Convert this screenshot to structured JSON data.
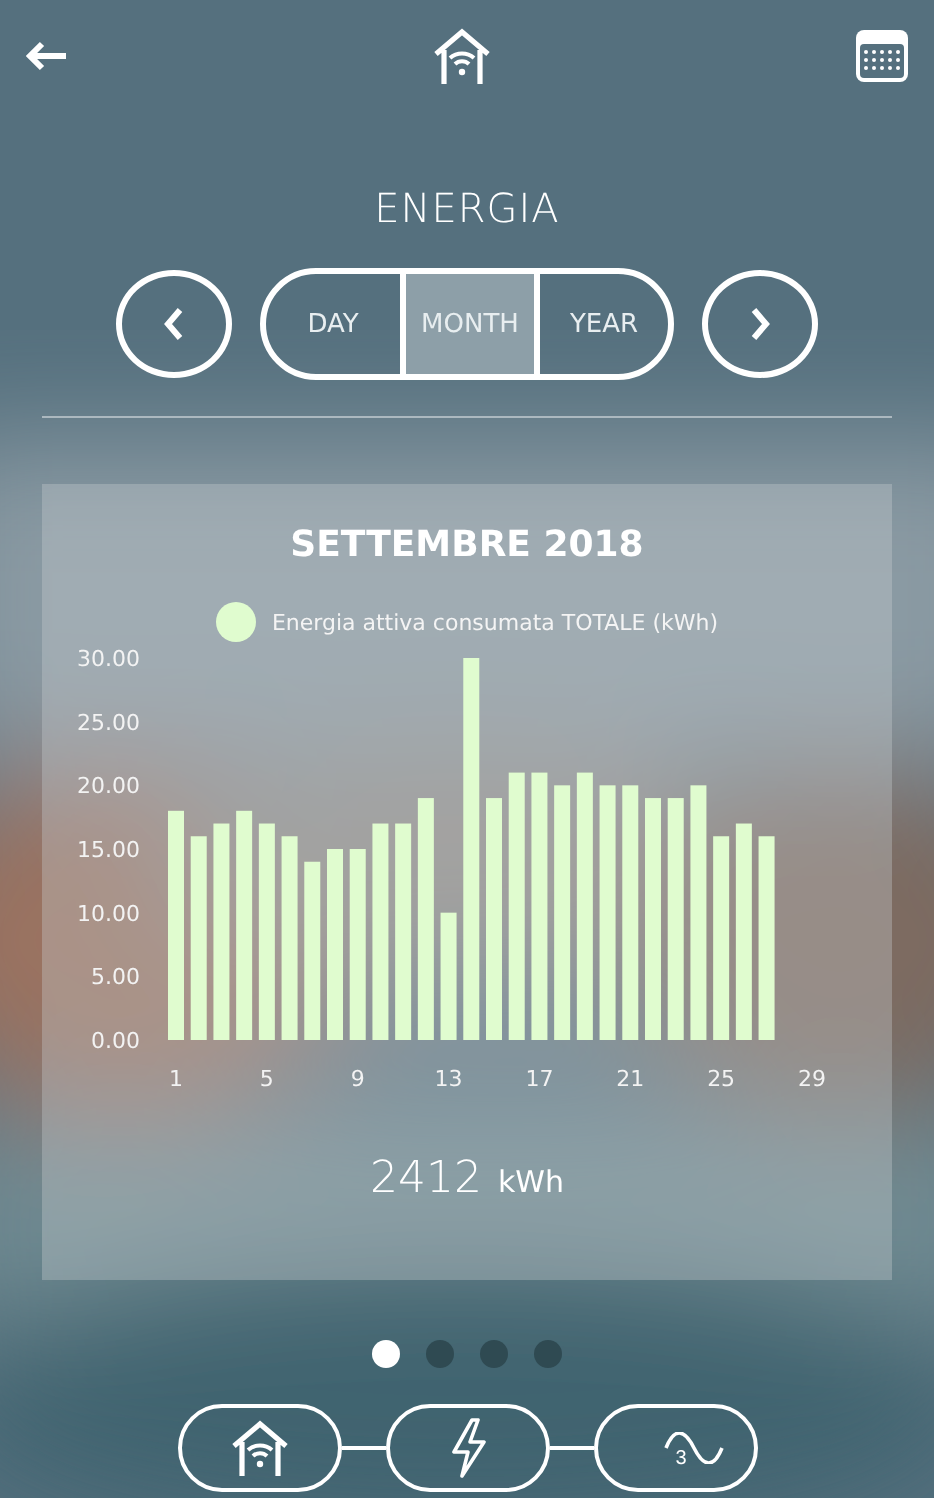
{
  "title": "ENERGIA",
  "periods": [
    {
      "label": "DAY",
      "selected": false
    },
    {
      "label": "MONTH",
      "selected": true
    },
    {
      "label": "YEAR",
      "selected": false
    }
  ],
  "card": {
    "title": "SETTEMBRE 2018",
    "chart_data": {
      "type": "bar",
      "x": [
        1,
        2,
        3,
        4,
        5,
        6,
        7,
        8,
        9,
        10,
        11,
        12,
        13,
        14,
        15,
        16,
        17,
        18,
        19,
        20,
        21,
        22,
        23,
        24,
        25,
        26,
        27
      ],
      "series": [
        {
          "name": "Energia attiva consumata TOTALE (kWh)",
          "color": "#e0fccf",
          "values": [
            18,
            16,
            17,
            18,
            17,
            16,
            14,
            15,
            15,
            17,
            17,
            19,
            10,
            30,
            19,
            21,
            21,
            20,
            21,
            20,
            20,
            19,
            19,
            20,
            16,
            17,
            16
          ]
        }
      ],
      "xlim": [
        1,
        29
      ],
      "ylim": [
        0,
        30
      ],
      "xticks": [
        1,
        5,
        9,
        13,
        17,
        21,
        25,
        29
      ],
      "yticks": [
        {
          "value": 0,
          "label": "0.00"
        },
        {
          "value": 5,
          "label": "5.00"
        },
        {
          "value": 10,
          "label": "10.00"
        },
        {
          "value": 15,
          "label": "15.00"
        },
        {
          "value": 20,
          "label": "20.00"
        },
        {
          "value": 25,
          "label": "25.00"
        },
        {
          "value": 30,
          "label": "30.00"
        }
      ]
    },
    "total": {
      "value": "2412",
      "unit": "kWh"
    }
  },
  "pages": [
    {
      "selected": true
    },
    {
      "selected": false
    },
    {
      "selected": false
    },
    {
      "selected": false
    }
  ],
  "bottom_nav": [
    {
      "kind": "home"
    },
    {
      "kind": "power"
    },
    {
      "kind": "three-phase",
      "label": "3"
    }
  ]
}
